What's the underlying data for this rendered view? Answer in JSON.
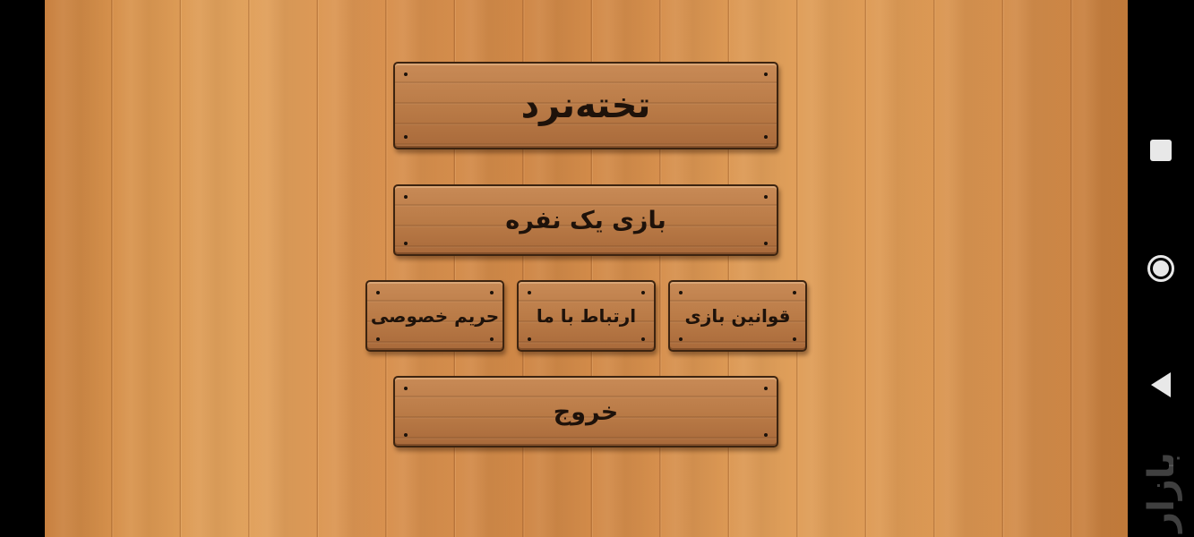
{
  "menu": {
    "title": "تخته‌نرد",
    "single_player": "بازی یک نفره",
    "privacy": "حریم خصوصی",
    "contact": "ارتباط با ما",
    "rules": "قوانین بازی",
    "exit": "خروج"
  },
  "navbar": {
    "icons": [
      "recents-icon",
      "home-icon",
      "back-icon"
    ]
  },
  "watermark": {
    "text": "بازار"
  },
  "colors": {
    "wood_light": "#e2a35e",
    "wood_dark": "#c27a3a",
    "plank": "#b97a46",
    "text": "#1e120a"
  }
}
